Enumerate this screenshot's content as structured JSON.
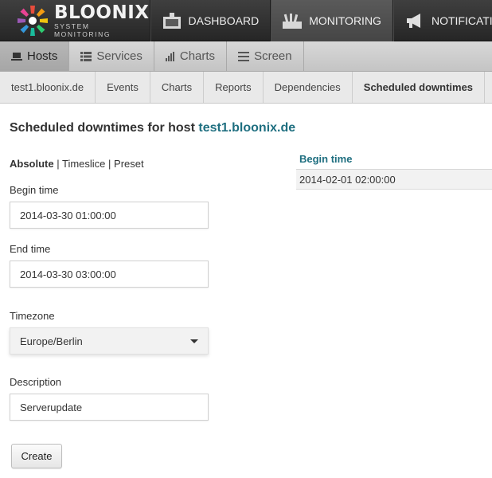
{
  "app": {
    "logo_title": "BLOONIX",
    "logo_subtitle": "SYSTEM MONITORING"
  },
  "topnav": [
    {
      "label": "DASHBOARD",
      "icon": "dashboard-icon"
    },
    {
      "label": "MONITORING",
      "icon": "monitoring-icon",
      "active": true
    },
    {
      "label": "NOTIFICATI",
      "icon": "megaphone-icon"
    }
  ],
  "subnav": [
    {
      "label": "Hosts",
      "icon": "laptop-icon",
      "active": true
    },
    {
      "label": "Services",
      "icon": "list-icon"
    },
    {
      "label": "Charts",
      "icon": "bar-chart-icon"
    },
    {
      "label": "Screen",
      "icon": "screen-icon"
    }
  ],
  "hostnav": [
    {
      "label": "test1.bloonix.de"
    },
    {
      "label": "Events"
    },
    {
      "label": "Charts"
    },
    {
      "label": "Reports"
    },
    {
      "label": "Dependencies"
    },
    {
      "label": "Scheduled downtimes",
      "active": true
    }
  ],
  "page": {
    "title_prefix": "Scheduled downtimes for host",
    "host": "test1.bloonix.de"
  },
  "modes": {
    "absolute": "Absolute",
    "sep1": " | ",
    "timeslice": "Timeslice",
    "sep2": " | ",
    "preset": "Preset"
  },
  "form": {
    "begin_label": "Begin time",
    "begin_value": "2014-03-30 01:00:00",
    "end_label": "End time",
    "end_value": "2014-03-30 03:00:00",
    "timezone_label": "Timezone",
    "timezone_value": "Europe/Berlin",
    "description_label": "Description",
    "description_value": "Serverupdate",
    "create_label": "Create"
  },
  "downtimes": {
    "header": "Begin time",
    "rows": [
      {
        "begin": "2014-02-01 02:00:00"
      }
    ]
  },
  "colors": {
    "accent": "#1f6f80",
    "topbar": "#2e2e2e"
  }
}
